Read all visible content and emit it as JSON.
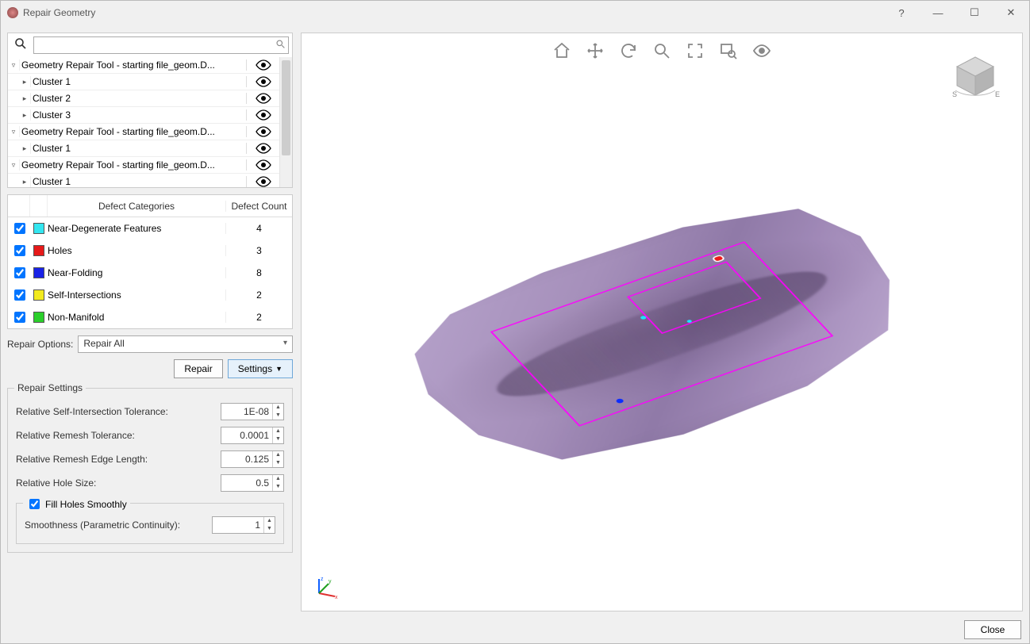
{
  "window": {
    "title": "Repair Geometry"
  },
  "search": {
    "placeholder": ""
  },
  "tree": [
    {
      "expander": "▿",
      "indent": 0,
      "label": "Geometry Repair Tool - starting file_geom.D..."
    },
    {
      "expander": "▸",
      "indent": 1,
      "label": "Cluster 1"
    },
    {
      "expander": "▸",
      "indent": 1,
      "label": "Cluster 2"
    },
    {
      "expander": "▸",
      "indent": 1,
      "label": "Cluster 3"
    },
    {
      "expander": "▿",
      "indent": 0,
      "label": "Geometry Repair Tool - starting file_geom.D..."
    },
    {
      "expander": "▸",
      "indent": 1,
      "label": "Cluster 1"
    },
    {
      "expander": "▿",
      "indent": 0,
      "label": "Geometry Repair Tool - starting file_geom.D..."
    },
    {
      "expander": "▸",
      "indent": 1,
      "label": "Cluster 1"
    }
  ],
  "defects": {
    "header_categories": "Defect Categories",
    "header_count": "Defect Count",
    "rows": [
      {
        "checked": true,
        "color": "#33e6f0",
        "name": "Near-Degenerate Features",
        "count": "4"
      },
      {
        "checked": true,
        "color": "#e61919",
        "name": "Holes",
        "count": "3"
      },
      {
        "checked": true,
        "color": "#1922e6",
        "name": "Near-Folding",
        "count": "8"
      },
      {
        "checked": true,
        "color": "#f2ea1f",
        "name": "Self-Intersections",
        "count": "2"
      },
      {
        "checked": true,
        "color": "#2bcf2b",
        "name": "Non-Manifold",
        "count": "2"
      }
    ]
  },
  "repair_options": {
    "label": "Repair Options:",
    "value": "Repair All"
  },
  "buttons": {
    "repair": "Repair",
    "settings": "Settings",
    "close": "Close"
  },
  "settings": {
    "legend": "Repair Settings",
    "self_intersection": {
      "label": "Relative Self-Intersection Tolerance:",
      "value": "1E-08"
    },
    "remesh_tol": {
      "label": "Relative Remesh Tolerance:",
      "value": "0.0001"
    },
    "remesh_edge": {
      "label": "Relative Remesh Edge Length:",
      "value": "0.125"
    },
    "hole_size": {
      "label": "Relative Hole Size:",
      "value": "0.5"
    },
    "fill_holes": {
      "label": "Fill Holes Smoothly",
      "checked": true
    },
    "smoothness": {
      "label": "Smoothness (Parametric Continuity):",
      "value": "1"
    }
  },
  "viewport_tools": [
    "home",
    "move",
    "undo",
    "zoom",
    "fit",
    "zoom-rect",
    "view-mode"
  ],
  "compass": {
    "s": "S",
    "e": "E"
  }
}
